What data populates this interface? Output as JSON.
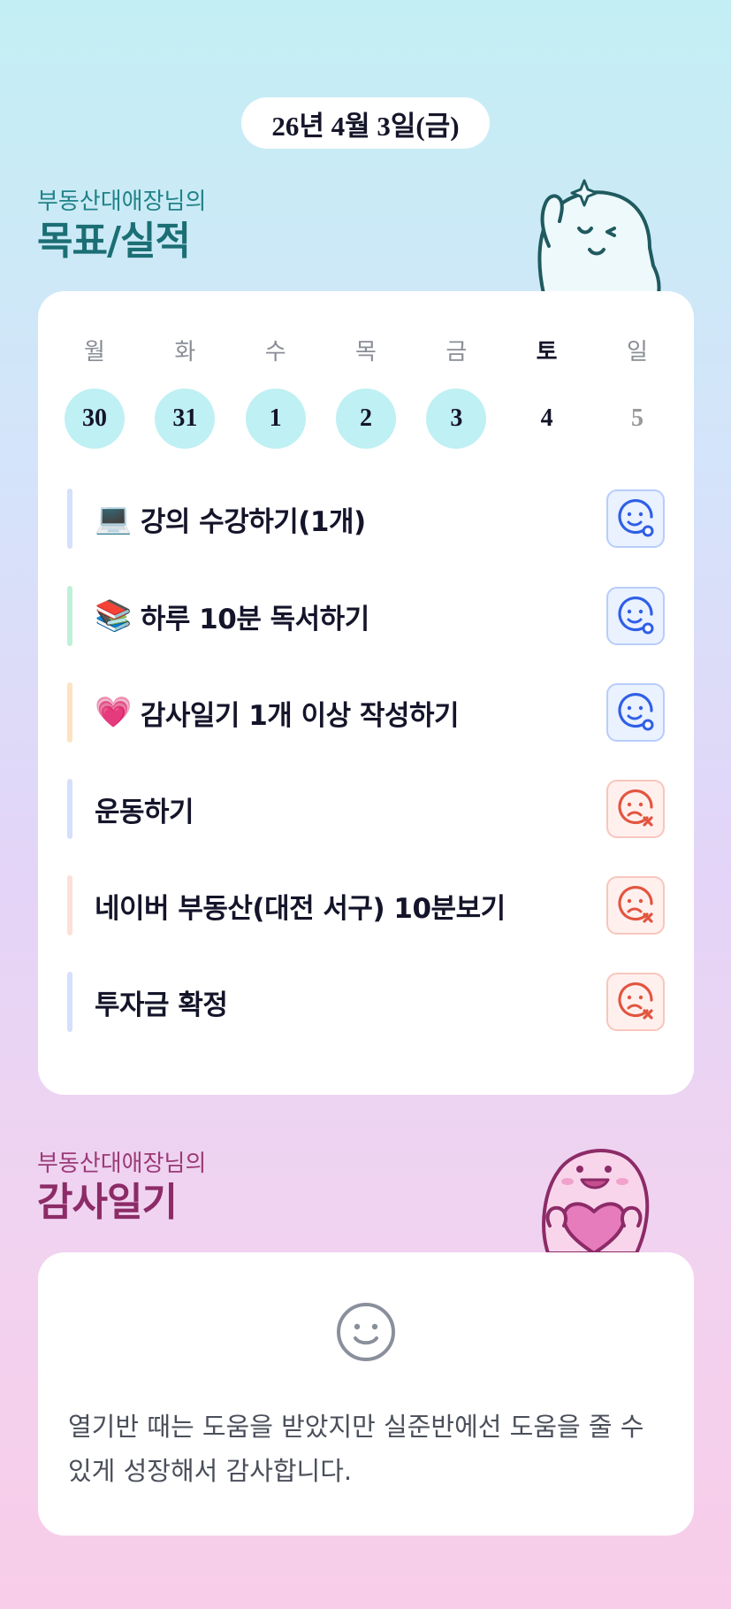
{
  "date": "26년 4월 3일(금)",
  "goals_section": {
    "subtitle": "부동산대애장님의",
    "title": "목표/실적"
  },
  "week": {
    "days": [
      "월",
      "화",
      "수",
      "목",
      "금",
      "토",
      "일"
    ],
    "dates": [
      "30",
      "31",
      "1",
      "2",
      "3",
      "4",
      "5"
    ]
  },
  "goals": [
    {
      "icon": "laptop-icon",
      "emoji": "💻",
      "label": "강의 수강하기(1개)",
      "status": "achieved",
      "color": "#d6dffb"
    },
    {
      "icon": "books-icon",
      "emoji": "📚",
      "label": "하루 10분 독서하기",
      "status": "achieved",
      "color": "#bff0d9"
    },
    {
      "icon": "heart-icon",
      "emoji": "💗",
      "label": "감사일기 1개 이상 작성하기",
      "status": "achieved",
      "color": "#fde3c2"
    },
    {
      "icon": "",
      "emoji": "",
      "label": "운동하기",
      "status": "failed",
      "color": "#d6dffb"
    },
    {
      "icon": "",
      "emoji": "",
      "label": "네이버 부동산(대전 서구) 10분보기",
      "status": "failed",
      "color": "#fde0d8"
    },
    {
      "icon": "",
      "emoji": "",
      "label": "투자금 확정",
      "status": "failed",
      "color": "#d6dffb"
    }
  ],
  "diary_section": {
    "subtitle": "부동산대애장님의",
    "title": "감사일기"
  },
  "diary": {
    "icon": "smile-icon",
    "text": "열기반 때는 도움을 받았지만 실준반에선 도움을 줄 수 있게 성장해서 감사합니다."
  },
  "colors": {
    "achieved": "#2f5fe6",
    "failed": "#e2553f",
    "done_date_bg": "#bff0f3"
  }
}
